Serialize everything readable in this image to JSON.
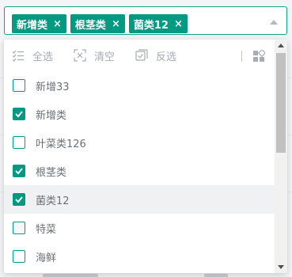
{
  "select": {
    "tags": [
      {
        "label": "新增类"
      },
      {
        "label": "根茎类"
      },
      {
        "label": "菌类12"
      }
    ],
    "tag_close_glyph": "×"
  },
  "toolbar": {
    "select_all_label": "全选",
    "clear_label": "清空",
    "invert_label": "反选"
  },
  "options": [
    {
      "label": "新增33",
      "checked": false
    },
    {
      "label": "新增类",
      "checked": true
    },
    {
      "label": "叶菜类126",
      "checked": false
    },
    {
      "label": "根茎类",
      "checked": true
    },
    {
      "label": "菌类12",
      "checked": true
    },
    {
      "label": "特菜",
      "checked": false
    },
    {
      "label": "海鲜",
      "checked": false
    }
  ],
  "colors": {
    "accent": "#009a82",
    "border_focus": "#17a38b",
    "muted_text": "#a7adb3",
    "option_text": "#6b7178"
  }
}
